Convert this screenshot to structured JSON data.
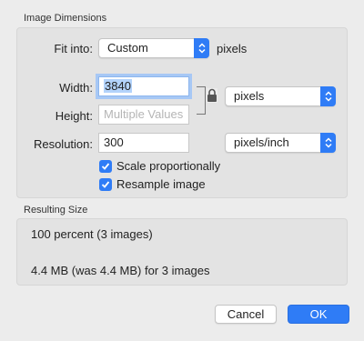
{
  "image_dimensions": {
    "title": "Image Dimensions",
    "fit_into": {
      "label": "Fit into:",
      "value": "Custom",
      "unit": "pixels"
    },
    "width": {
      "label": "Width:",
      "value": "3840"
    },
    "height": {
      "label": "Height:",
      "placeholder": "Multiple Values"
    },
    "size_unit": "pixels",
    "resolution": {
      "label": "Resolution:",
      "value": "300",
      "unit": "pixels/inch"
    },
    "scale_proportionally": {
      "label": "Scale proportionally",
      "checked": true
    },
    "resample_image": {
      "label": "Resample image",
      "checked": true
    }
  },
  "resulting_size": {
    "title": "Resulting Size",
    "line1": "100 percent (3 images)",
    "line2": "4.4 MB (was 4.4 MB) for 3 images"
  },
  "buttons": {
    "cancel": "Cancel",
    "ok": "OK"
  },
  "colors": {
    "accent": "#2f7cf6",
    "selection": "#b3d3fb",
    "focus_ring": "#a7c8f5"
  }
}
